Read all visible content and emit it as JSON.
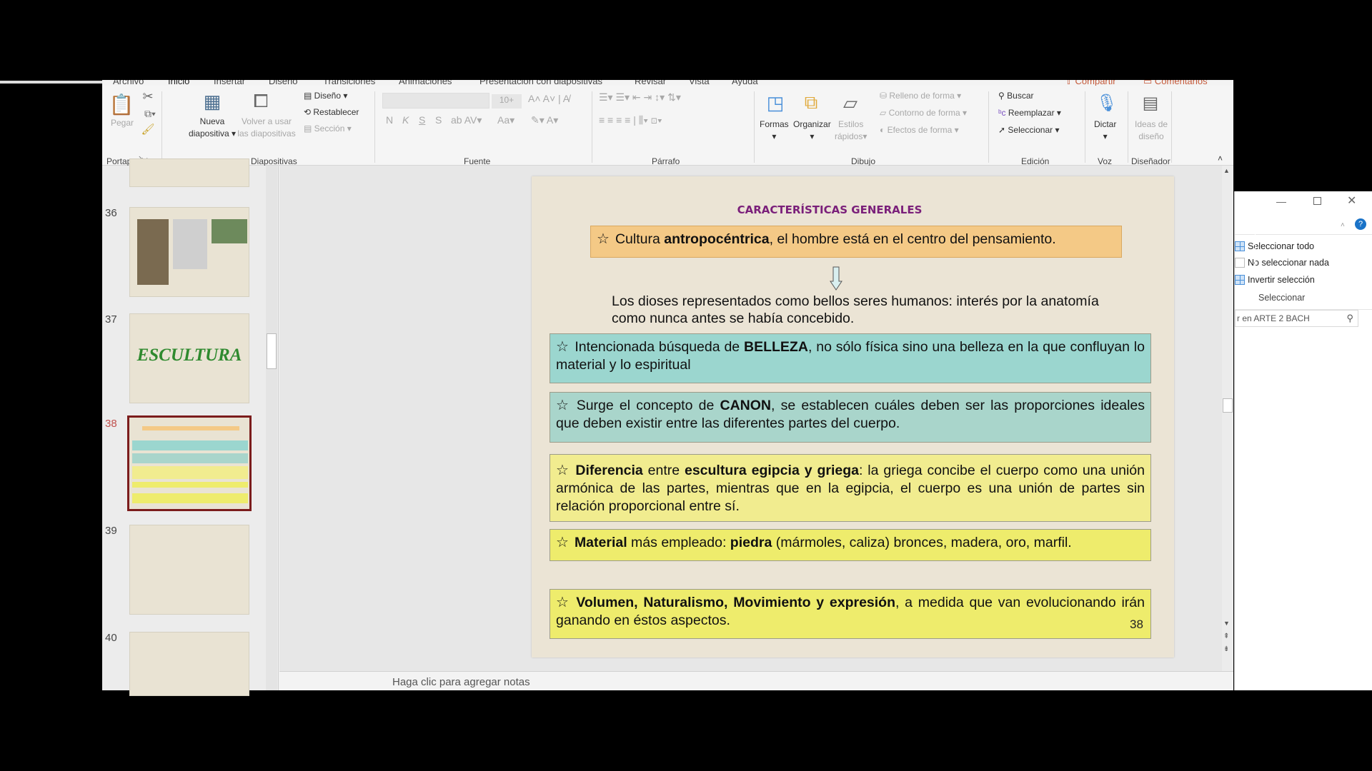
{
  "ribbon": {
    "tabs": [
      "Archivo",
      "Inicio",
      "Insertar",
      "Diseño",
      "Transiciones",
      "Animaciones",
      "Presentación con diapositivas",
      "Revisar",
      "Vista",
      "Ayuda"
    ],
    "share": "Compartir",
    "comments": "Comentarios",
    "portapapeles": {
      "label": "Portapapeles",
      "paste": "Pegar"
    },
    "diapositivas": {
      "label": "Diapositivas",
      "new1": "Nueva",
      "new2": "diapositiva",
      "reuse1": "Volver a usar",
      "reuse2": "las diapositivas",
      "layout": "Diseño",
      "reset": "Restablecer",
      "section": "Sección"
    },
    "fuente": {
      "label": "Fuente",
      "size": "10+",
      "bold": "N",
      "italic": "K",
      "underline": "S",
      "shadow": "S",
      "case": "Aa"
    },
    "parrafo": {
      "label": "Párrafo"
    },
    "dibujo": {
      "label": "Dibujo",
      "shapes": "Formas",
      "arrange": "Organizar",
      "styles1": "Estilos",
      "styles2": "rápidos",
      "fill": "Relleno de forma",
      "outline": "Contorno de forma",
      "effects": "Efectos de forma"
    },
    "edicion": {
      "label": "Edición",
      "find": "Buscar",
      "replace": "Reemplazar",
      "select": "Seleccionar"
    },
    "voz": {
      "label": "Voz",
      "dictate": "Dictar"
    },
    "disenador": {
      "label": "Diseñador",
      "ideas1": "Ideas de",
      "ideas2": "diseño"
    }
  },
  "thumbnails": [
    {
      "num": "36"
    },
    {
      "num": "37",
      "title": "ESCULTURA"
    },
    {
      "num": "38",
      "selected": true
    },
    {
      "num": "39"
    },
    {
      "num": "40"
    }
  ],
  "slide": {
    "title": "CARACTERÍSTICAS GENERALES",
    "b1": {
      "a": "Cultura ",
      "b": "antropocéntrica",
      "c": ", el hombre está en el centro del pensamiento."
    },
    "para": "Los dioses representados como bellos seres humanos: interés por la anatomía como nunca antes se había concebido.",
    "b2": {
      "a": "Intencionada búsqueda de ",
      "b": "BELLEZA",
      "c": ", no sólo física sino una belleza en la que confluyan lo material y lo espiritual"
    },
    "b3": {
      "a": "Surge el concepto de ",
      "b": "CANON",
      "c": ", se establecen cuáles deben ser las proporciones ideales que deben existir entre las diferentes partes del cuerpo."
    },
    "b4": {
      "a": "Diferencia",
      "b": " entre ",
      "c": "escultura egipcia y griega",
      "d": ": la griega concibe el cuerpo como una unión armónica de las partes, mientras que en la egipcia, el cuerpo es una unión de partes sin relación proporcional entre sí."
    },
    "b5": {
      "a": "Material",
      "b": " más empleado: ",
      "c": "piedra",
      "d": " (mármoles, caliza) bronces, madera, oro, marfil."
    },
    "b6": {
      "a": "Volumen, Naturalismo, Movimiento y expresión",
      "b": ", a medida que van evolucionando irán ganando en éstos aspectos."
    },
    "page": "38",
    "colors": {
      "orange": "#f4c986",
      "teal": "#9bd6cf",
      "teal2": "#a9d5cb",
      "yellow": "#f1ec8f",
      "yellow2": "#eeec6c"
    }
  },
  "notes": "Haga clic para agregar notas",
  "explorer": {
    "select_all": "Seleccionar todo",
    "select_none": "No seleccionar nada",
    "invert": "Invertir selección",
    "group": "Seleccionar",
    "search": "r en ARTE 2 BACH"
  }
}
